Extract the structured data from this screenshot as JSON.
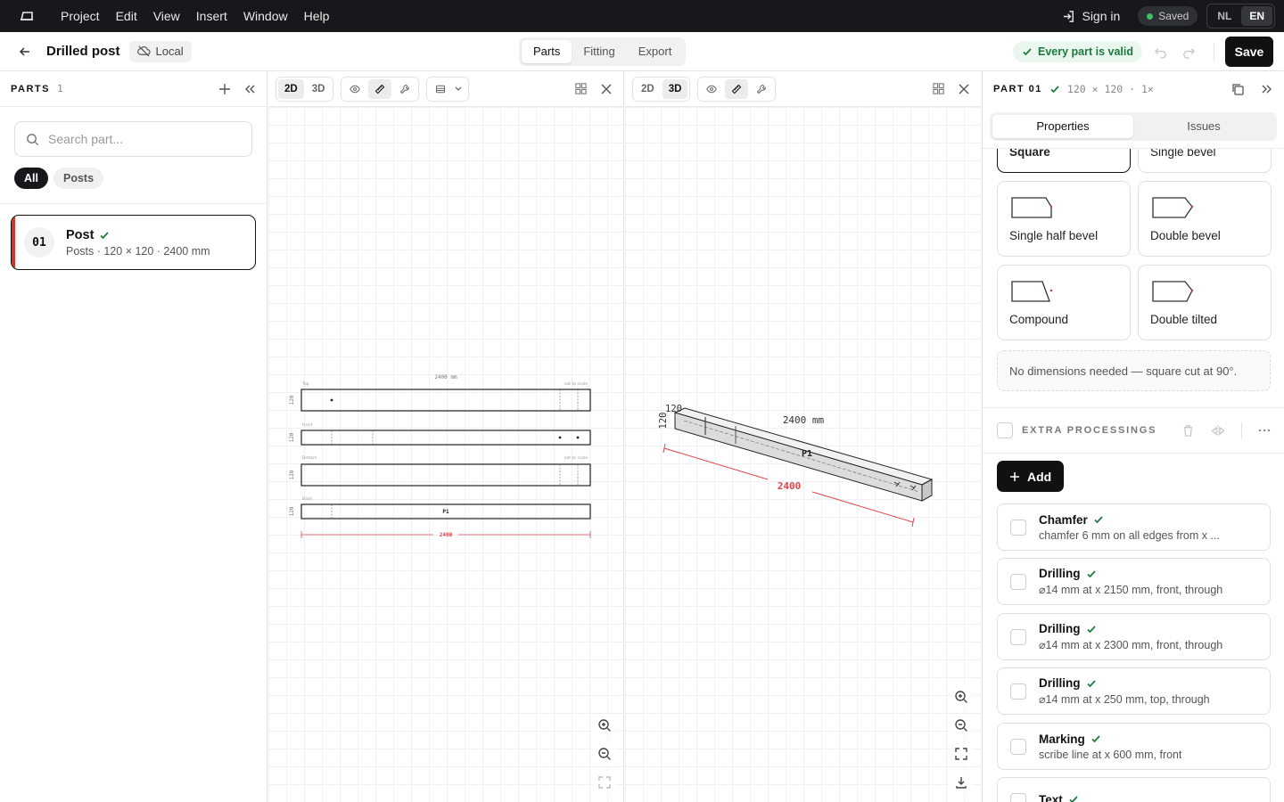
{
  "menubar": {
    "items": [
      "Project",
      "Edit",
      "View",
      "Insert",
      "Window",
      "Help"
    ],
    "sign_in": "Sign in",
    "saved": "Saved",
    "languages": [
      "NL",
      "EN"
    ]
  },
  "titlebar": {
    "doc_name": "Drilled post",
    "location": "Local",
    "tabs": [
      "Parts",
      "Fitting",
      "Export"
    ],
    "validity": "Every part is valid",
    "save": "Save"
  },
  "parts_panel": {
    "title": "PARTS",
    "count": "1",
    "search_placeholder": "Search part...",
    "filters": [
      "All",
      "Posts"
    ],
    "parts": [
      {
        "number": "01",
        "name": "Post",
        "detail": "Posts · 120 × 120 · 2400 mm"
      }
    ]
  },
  "viewport_2d": {
    "modes": [
      "2D",
      "3D"
    ],
    "length_label": "2400 mm",
    "dimension": "2400",
    "views": [
      "Top",
      "Front",
      "Bottom",
      "Back"
    ],
    "height_label": "120",
    "not_to_scale": "not to scale",
    "part_tag": "P1"
  },
  "viewport_3d": {
    "modes": [
      "2D",
      "3D"
    ],
    "length_label": "2400 mm",
    "dimension": "2400",
    "section_a": "120",
    "section_b": "120",
    "part_tag": "P1"
  },
  "properties": {
    "part_label": "PART 01",
    "part_meta": "120 × 120 · 1×",
    "tabs": [
      "Properties",
      "Issues"
    ],
    "cuts": [
      "Square",
      "Single bevel",
      "Single half bevel",
      "Double bevel",
      "Compound",
      "Double tilted"
    ],
    "cut_note": "No dimensions needed — square cut at 90°.",
    "extra_title": "EXTRA PROCESSINGS",
    "add_label": "Add",
    "processings": [
      {
        "title": "Chamfer",
        "detail": "chamfer 6 mm on all edges from x ..."
      },
      {
        "title": "Drilling",
        "detail": "⌀14 mm at x 2150 mm, front, through"
      },
      {
        "title": "Drilling",
        "detail": "⌀14 mm at x 2300 mm, front, through"
      },
      {
        "title": "Drilling",
        "detail": "⌀14 mm at x 250 mm, top, through"
      },
      {
        "title": "Marking",
        "detail": "scribe line at x 600 mm, front"
      },
      {
        "title": "Text",
        "detail": ""
      }
    ]
  },
  "colors": {
    "accent": "#d0342c",
    "valid": "#1d7a3e",
    "dark": "#16181b"
  }
}
